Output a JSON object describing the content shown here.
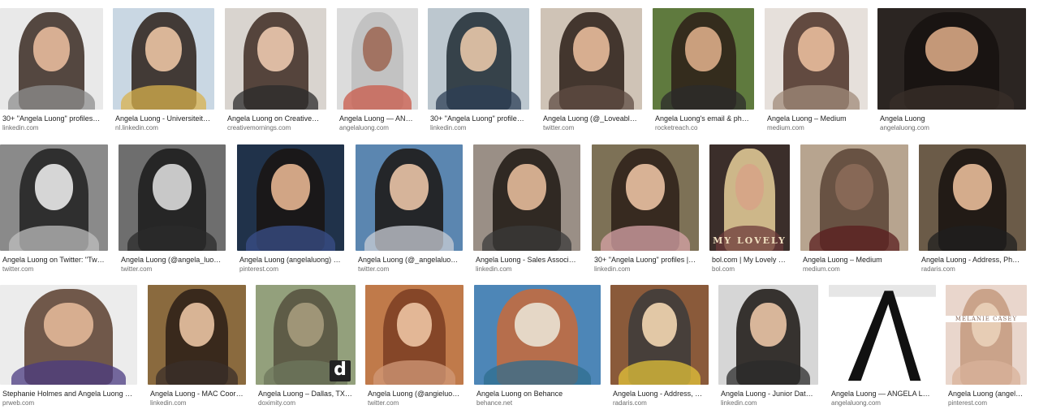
{
  "results": [
    {
      "title": "30+ \"Angela Luong\" profiles | L...",
      "source": "linkedin.com",
      "colors": {
        "bg": "#e9e9e9",
        "hair": "#3a2a22",
        "face": "#e4b89a",
        "body": "#8d8d8d"
      }
    },
    {
      "title": "Angela Luong - Universiteit va...",
      "source": "nl.linkedin.com",
      "colors": {
        "bg": "#c9d7e3",
        "hair": "#2a1e18",
        "face": "#e7c1a1",
        "body": "#d8b24e"
      }
    },
    {
      "title": "Angela Luong on CreativeMor...",
      "source": "creativemornings.com",
      "colors": {
        "bg": "#d9d4cf",
        "hair": "#3d2a22",
        "face": "#e9c5ac",
        "body": "#2b2b2b"
      }
    },
    {
      "title": "Angela Luong — ANGE...",
      "source": "angelaluong.com",
      "colors": {
        "bg": "#dcdcdc",
        "hair": "#bdbdbd",
        "face": "#a06d5a",
        "body": "#c95a4a"
      }
    },
    {
      "title": "30+ \"Angela Luong\" profiles | L...",
      "source": "linkedin.com",
      "colors": {
        "bg": "#bcc7cf",
        "hair": "#1f2a33",
        "face": "#e4c4a7",
        "body": "#2e3f55"
      }
    },
    {
      "title": "Angela Luong (@_LoveableAn...",
      "source": "twitter.com",
      "colors": {
        "bg": "#cfc3b6",
        "hair": "#2a1d16",
        "face": "#e4b999",
        "body": "#5f4c43"
      }
    },
    {
      "title": "Angela Luong's email & phone...",
      "source": "rocketreach.co",
      "colors": {
        "bg": "#5f7a3e",
        "hair": "#2d1f18",
        "face": "#d7a986",
        "body": "#2b2b2b"
      }
    },
    {
      "title": "Angela Luong – Medium",
      "source": "medium.com",
      "colors": {
        "bg": "#e6e0db",
        "hair": "#4a2f24",
        "face": "#e5ba9a",
        "body": "#a08b7a"
      }
    },
    {
      "title": "Angela Luong",
      "source": "angelaluong.com",
      "colors": {
        "bg": "#2b2522",
        "hair": "#16120f",
        "face": "#d3a481",
        "body": "#3a2f2a"
      }
    },
    {
      "title": "Angela Luong on Twitter: \"Twitte...",
      "source": "twitter.com",
      "colors": {
        "bg": "#8a8a8a",
        "hair": "#1e1e1e",
        "face": "#e5e5e5",
        "body": "#bdbdbd"
      }
    },
    {
      "title": "Angela Luong (@angela_luong1)...",
      "source": "twitter.com",
      "colors": {
        "bg": "#6e6e6e",
        "hair": "#1a1a1a",
        "face": "#d6d6d6",
        "body": "#2b2b2b"
      }
    },
    {
      "title": "Angela Luong (angelaluong) on ...",
      "source": "pinterest.com",
      "colors": {
        "bg": "#20324a",
        "hair": "#1a1410",
        "face": "#e1b28e",
        "body": "#3a4f8a"
      }
    },
    {
      "title": "Angela Luong (@_angelaluong) |...",
      "source": "twitter.com",
      "colors": {
        "bg": "#5b86b0",
        "hair": "#1b1512",
        "face": "#e6c0a4",
        "body": "#c9ced6"
      }
    },
    {
      "title": "Angela Luong - Sales Associate ...",
      "source": "linkedin.com",
      "colors": {
        "bg": "#9a8f86",
        "hair": "#1d1712",
        "face": "#e1b798",
        "body": "#3a3a3a"
      }
    },
    {
      "title": "30+ \"Angela Luong\" profiles | Lin...",
      "source": "linkedin.com",
      "colors": {
        "bg": "#7d7156",
        "hair": "#2a1d16",
        "face": "#e6bea0",
        "body": "#d8a4a8"
      }
    },
    {
      "title": "bol.com | My Lovely Lif...",
      "source": "bol.com",
      "colors": {
        "bg": "#3b2e2a",
        "hair": "#e7cf9a",
        "face": "#d7a487",
        "body": "#6b3a3a"
      }
    },
    {
      "title": "Angela Luong – Medium",
      "source": "medium.com",
      "colors": {
        "bg": "#b7a48f",
        "hair": "#5a4436",
        "face": "#8a6a58",
        "body": "#5a1e1e"
      }
    },
    {
      "title": "Angela Luong - Address, Phone ...",
      "source": "radaris.com",
      "colors": {
        "bg": "#6b5b48",
        "hair": "#15110e",
        "face": "#e4b997",
        "body": "#1f1f1f"
      }
    },
    {
      "title": "Stephanie Holmes and Angela Luong Join...",
      "source": "prweb.com",
      "colors": {
        "bg": "#ececec",
        "hair": "#5a3e2e",
        "face": "#e0b596",
        "body": "#4b3b82"
      }
    },
    {
      "title": "Angela Luong - MAC Coordin...",
      "source": "linkedin.com",
      "colors": {
        "bg": "#8a6a3e",
        "hair": "#2a1d16",
        "face": "#e6c0a0",
        "body": "#3a2f2a"
      }
    },
    {
      "title": "Angela Luong – Dallas, TX | P...",
      "source": "doximity.com",
      "colors": {
        "bg": "#93a07c",
        "hair": "#55503e",
        "face": "#a59a7c",
        "body": "#6e775c"
      }
    },
    {
      "title": "Angela Luong (@angieluong) | ...",
      "source": "twitter.com",
      "colors": {
        "bg": "#c07a4a",
        "hair": "#7a3d22",
        "face": "#ecc1a0",
        "body": "#d29a78"
      }
    },
    {
      "title": "Angela Luong on Behance",
      "source": "behance.net",
      "colors": {
        "bg": "#4d86b7",
        "hair": "#c96a3a",
        "face": "#e9e0d0",
        "body": "#2f6d8f"
      }
    },
    {
      "title": "Angela Luong - Address, Pho...",
      "source": "radaris.com",
      "colors": {
        "bg": "#8a5a3a",
        "hair": "#3b3b3b",
        "face": "#f0d4b0",
        "body": "#e2c33a"
      }
    },
    {
      "title": "Angela Luong - Junior Data A...",
      "source": "linkedin.com",
      "colors": {
        "bg": "#d6d6d6",
        "hair": "#1a1512",
        "face": "#e6c1a4",
        "body": "#2b2b2b"
      }
    },
    {
      "title": "Angela Luong — ANGELA LUON...",
      "source": "angelaluong.com",
      "colors": {
        "bg": "#ffffff",
        "hair": "#111111",
        "face": "#ffffff",
        "body": "#ffffff"
      }
    },
    {
      "title": "Angela Luong (angelajl...",
      "source": "pinterest.com",
      "colors": {
        "bg": "#e9d6cc",
        "hair": "#c49a7e",
        "face": "#e9d0b8",
        "body": "#d8b19a"
      }
    }
  ],
  "icons": {
    "doximity_badge": "d",
    "bol_caption": "MY LOVELY",
    "pinterest_caption": "MELANIE CASEY"
  }
}
